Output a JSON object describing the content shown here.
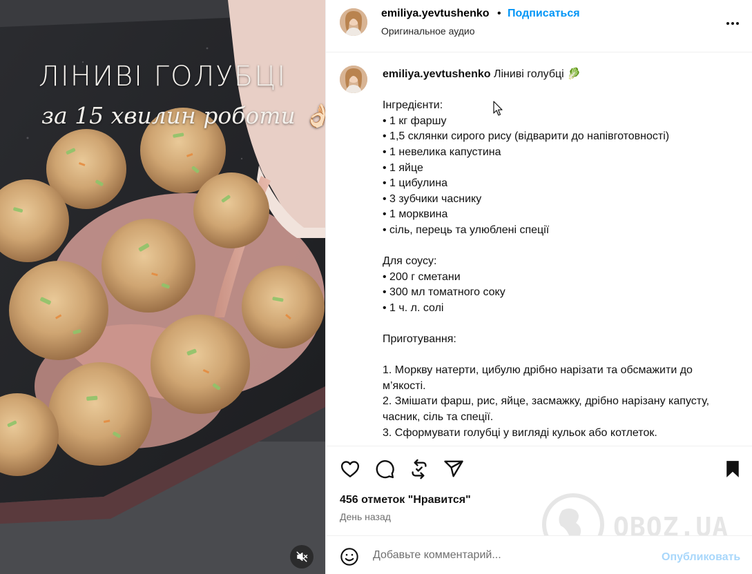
{
  "media": {
    "title": "ЛІНИВІ ГОЛУБЦІ",
    "subtitle": "за 15 хвилин роботи 👌🏻",
    "mute_icon": "speaker-muted-icon"
  },
  "header": {
    "username": "emiliya.yevtushenko",
    "separator": "•",
    "follow_label": "Подписаться",
    "audio_label": "Оригинальное аудио",
    "more_icon": "ellipsis-icon"
  },
  "caption": {
    "username": "emiliya.yevtushenko",
    "title": "Ліниві голубці 🥬",
    "ingredients_heading": "Інгредієнти:",
    "ingredients": [
      "• 1 кг фаршу",
      "• 1,5 склянки сирого рису (відварити до напівготовності)",
      "• 1 невелика капустина",
      "• 1 яйце",
      "• 1 цибулина",
      "• 3 зубчики часнику",
      "• 1 морквина",
      "• сіль, перець та улюблені спеції"
    ],
    "sauce_heading": "Для соусу:",
    "sauce": [
      "• 200 г сметани",
      "• 300 мл томатного соку",
      "• 1 ч. л. солі"
    ],
    "steps_heading": "Приготування:",
    "steps": [
      "1. Моркву натерти, цибулю дрібно нарізати та обсмажити до м’якості.",
      "2. Змішати фарш, рис, яйце, засмажку, дрібно нарізану капусту, часник, сіль та спеції.",
      "3. Сформувати голубці у вигляді кульок або котлеток."
    ]
  },
  "actions": {
    "like_icon": "heart-icon",
    "comment_icon": "comment-icon",
    "repost_icon": "repost-icon",
    "share_icon": "paper-plane-icon",
    "save_icon": "bookmark-filled-icon",
    "likes_text": "456 отметок \"Нравится\"",
    "time_text": "День назад"
  },
  "comment": {
    "placeholder": "Добавьте комментарий...",
    "publish_label": "Опубликовать",
    "emoji_icon": "smiley-icon"
  },
  "watermark": {
    "text": "OBOZ.UA"
  },
  "colors": {
    "accent": "#0095f6",
    "publish_disabled": "#a8d7fb",
    "muted_text": "#6f6f6f"
  }
}
